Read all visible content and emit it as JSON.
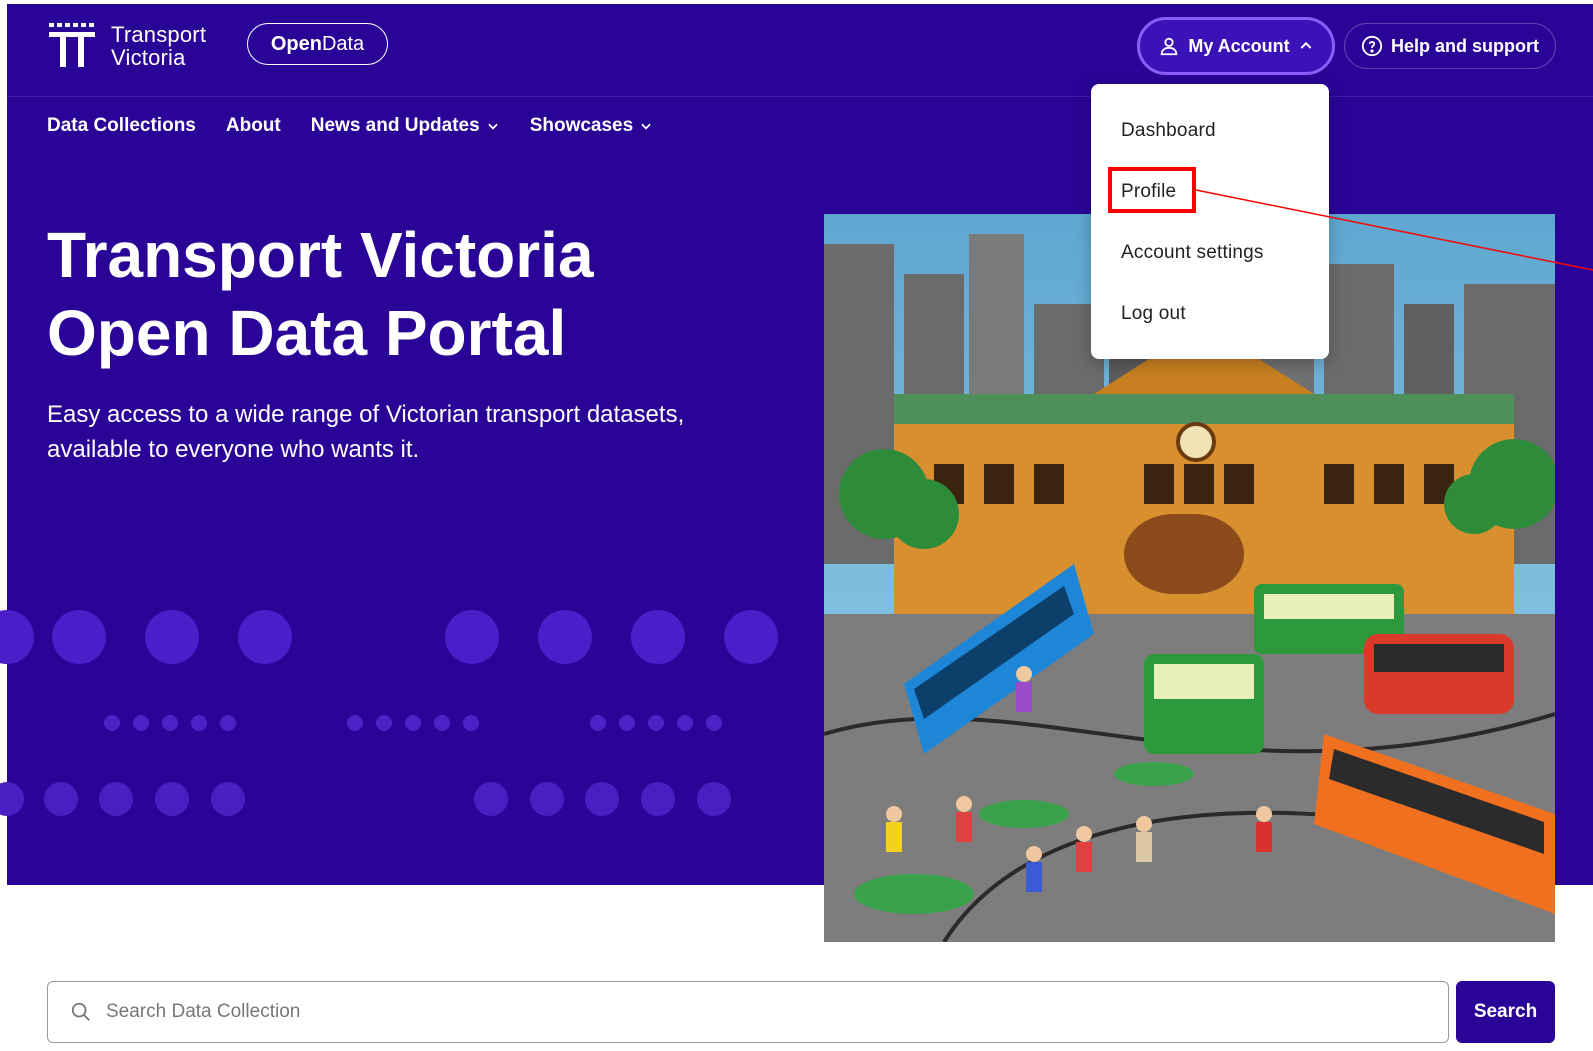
{
  "header": {
    "logo_line1": "Transport",
    "logo_line2": "Victoria",
    "opendata_bold": "Open",
    "opendata_light": "Data",
    "account_label": "My Account",
    "help_label": "Help and support"
  },
  "nav": {
    "items": [
      {
        "label": "Data Collections",
        "has_dropdown": false
      },
      {
        "label": "About",
        "has_dropdown": false
      },
      {
        "label": "News and Updates",
        "has_dropdown": true
      },
      {
        "label": "Showcases",
        "has_dropdown": true
      }
    ]
  },
  "hero": {
    "title_line1": "Transport Victoria",
    "title_line2": "Open Data Portal",
    "subtitle_line1": "Easy access to a wide range of Victorian transport datasets,",
    "subtitle_line2": "available to everyone who wants it."
  },
  "account_menu": {
    "expanded": true,
    "items": [
      "Dashboard",
      "Profile",
      "Account settings",
      "Log out"
    ],
    "highlighted": "Profile"
  },
  "search": {
    "placeholder": "Search Data Collection",
    "value": "",
    "button_label": "Search"
  },
  "colors": {
    "brand_purple": "#2a0497",
    "accent_violet": "#8b5cf6",
    "annotation_red": "#ff0000"
  }
}
